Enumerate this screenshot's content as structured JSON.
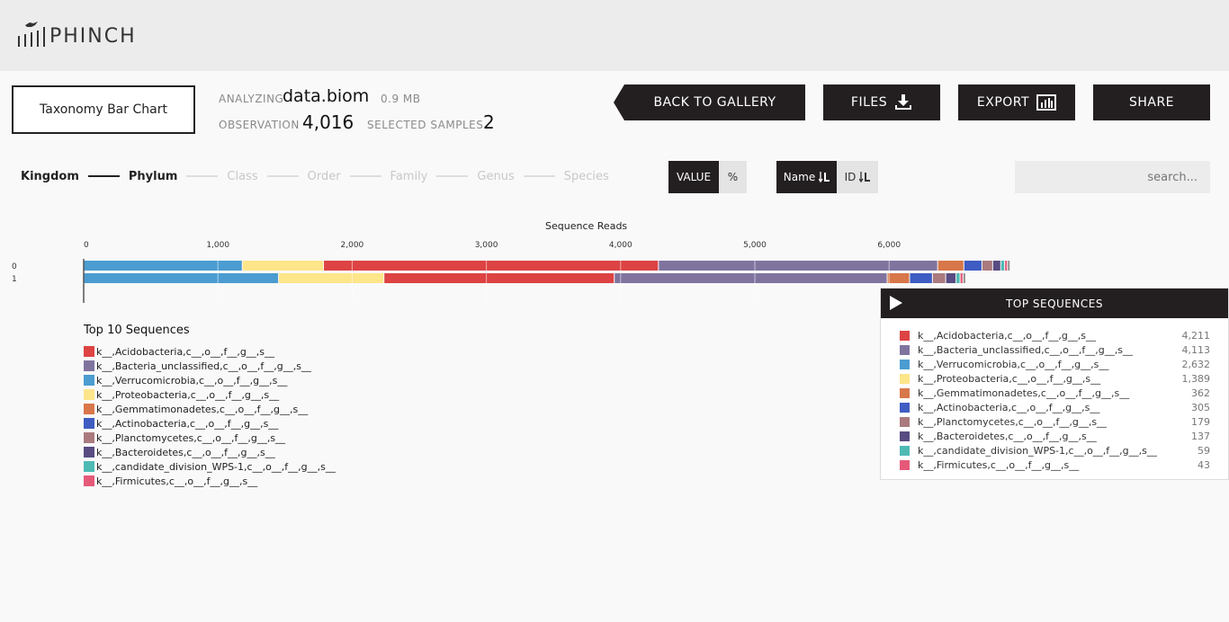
{
  "brand": {
    "name": "PHINCH"
  },
  "viz": {
    "name": "Taxonomy Bar Chart"
  },
  "file": {
    "analyzing_label": "ANALYZING",
    "name": "data.biom",
    "size": "0.9 MB",
    "observation_label": "OBSERVATION",
    "observation": "4,016",
    "selected_label": "SELECTED SAMPLES",
    "selected": "2"
  },
  "actions": {
    "back": "BACK TO GALLERY",
    "files": "FILES",
    "export": "EXPORT",
    "share": "SHARE"
  },
  "levels": [
    "Kingdom",
    "Phylum",
    "Class",
    "Order",
    "Family",
    "Genus",
    "Species"
  ],
  "active_level_count": 2,
  "display_mode": {
    "value": "VALUE",
    "percent": "%",
    "selected": "VALUE"
  },
  "sort": {
    "name": "Name",
    "id": "ID",
    "selected": "Name"
  },
  "search": {
    "placeholder": "search..."
  },
  "chart_data": {
    "type": "bar",
    "orientation": "horizontal",
    "stacked": true,
    "title": "Sequence Reads",
    "xlim": [
      0,
      7000
    ],
    "xticks": [
      "0",
      "1,000",
      "2,000",
      "3,000",
      "4,000",
      "5,000",
      "6,000"
    ],
    "xtick_values": [
      0,
      1000,
      2000,
      3000,
      4000,
      5000,
      6000
    ],
    "categories": [
      "0",
      "1"
    ],
    "series": [
      {
        "name": "k__,Verrucomicrobia,c__,o__,f__,g__,s__",
        "color": "#4b9cd0",
        "values": [
          1185,
          1455
        ]
      },
      {
        "name": "k__,Proteobacteria,c__,o__,f__,g__,s__",
        "color": "#fde58a",
        "values": [
          605,
          785
        ]
      },
      {
        "name": "k__,Acidobacteria,c__,o__,f__,g__,s__",
        "color": "#dd4343",
        "values": [
          2495,
          1716
        ]
      },
      {
        "name": "k__,Bacteria_unclassified,c__,o__,f__,g__,s__",
        "color": "#80749f",
        "values": [
          2080,
          2033
        ]
      },
      {
        "name": "k__,Gemmatimonadetes,c__,o__,f__,g__,s__",
        "color": "#d8774a",
        "values": [
          195,
          167
        ]
      },
      {
        "name": "k__,Actinobacteria,c__,o__,f__,g__,s__",
        "color": "#3e5cc2",
        "values": [
          135,
          170
        ]
      },
      {
        "name": "k__,Planctomycetes,c__,o__,f__,g__,s__",
        "color": "#aa7a7f",
        "values": [
          80,
          99
        ]
      },
      {
        "name": "k__,Bacteroidetes,c__,o__,f__,g__,s__",
        "color": "#584c82",
        "values": [
          60,
          77
        ]
      },
      {
        "name": "k__,candidate_division_WPS-1,c__,o__,f__,g__,s__",
        "color": "#4ebab4",
        "values": [
          29,
          30
        ]
      },
      {
        "name": "k__,Firmicutes,c__,o__,f__,g__,s__",
        "color": "#e55a78",
        "values": [
          21,
          22
        ]
      },
      {
        "name": "other",
        "color": "#8f8f8f",
        "values": [
          20,
          20
        ]
      }
    ]
  },
  "legend": {
    "title": "Top 10 Sequences",
    "items": [
      {
        "label": "k__,Acidobacteria,c__,o__,f__,g__,s__",
        "color": "#dd4343"
      },
      {
        "label": "k__,Bacteria_unclassified,c__,o__,f__,g__,s__",
        "color": "#80749f"
      },
      {
        "label": "k__,Verrucomicrobia,c__,o__,f__,g__,s__",
        "color": "#4b9cd0"
      },
      {
        "label": "k__,Proteobacteria,c__,o__,f__,g__,s__",
        "color": "#fde58a"
      },
      {
        "label": "k__,Gemmatimonadetes,c__,o__,f__,g__,s__",
        "color": "#d8774a"
      },
      {
        "label": "k__,Actinobacteria,c__,o__,f__,g__,s__",
        "color": "#3e5cc2"
      },
      {
        "label": "k__,Planctomycetes,c__,o__,f__,g__,s__",
        "color": "#aa7a7f"
      },
      {
        "label": "k__,Bacteroidetes,c__,o__,f__,g__,s__",
        "color": "#584c82"
      },
      {
        "label": "k__,candidate_division_WPS-1,c__,o__,f__,g__,s__",
        "color": "#4ebab4"
      },
      {
        "label": "k__,Firmicutes,c__,o__,f__,g__,s__",
        "color": "#e55a78"
      }
    ]
  },
  "top_sequences": {
    "title": "TOP SEQUENCES",
    "items": [
      {
        "label": "k__,Acidobacteria,c__,o__,f__,g__,s__",
        "count": "4,211",
        "color": "#dd4343"
      },
      {
        "label": "k__,Bacteria_unclassified,c__,o__,f__,g__,s__",
        "count": "4,113",
        "color": "#80749f"
      },
      {
        "label": "k__,Verrucomicrobia,c__,o__,f__,g__,s__",
        "count": "2,632",
        "color": "#4b9cd0"
      },
      {
        "label": "k__,Proteobacteria,c__,o__,f__,g__,s__",
        "count": "1,389",
        "color": "#fde58a"
      },
      {
        "label": "k__,Gemmatimonadetes,c__,o__,f__,g__,s__",
        "count": "362",
        "color": "#d8774a"
      },
      {
        "label": "k__,Actinobacteria,c__,o__,f__,g__,s__",
        "count": "305",
        "color": "#3e5cc2"
      },
      {
        "label": "k__,Planctomycetes,c__,o__,f__,g__,s__",
        "count": "179",
        "color": "#aa7a7f"
      },
      {
        "label": "k__,Bacteroidetes,c__,o__,f__,g__,s__",
        "count": "137",
        "color": "#584c82"
      },
      {
        "label": "k__,candidate_division_WPS-1,c__,o__,f__,g__,s__",
        "count": "59",
        "color": "#4ebab4"
      },
      {
        "label": "k__,Firmicutes,c__,o__,f__,g__,s__",
        "count": "43",
        "color": "#e55a78"
      }
    ]
  }
}
